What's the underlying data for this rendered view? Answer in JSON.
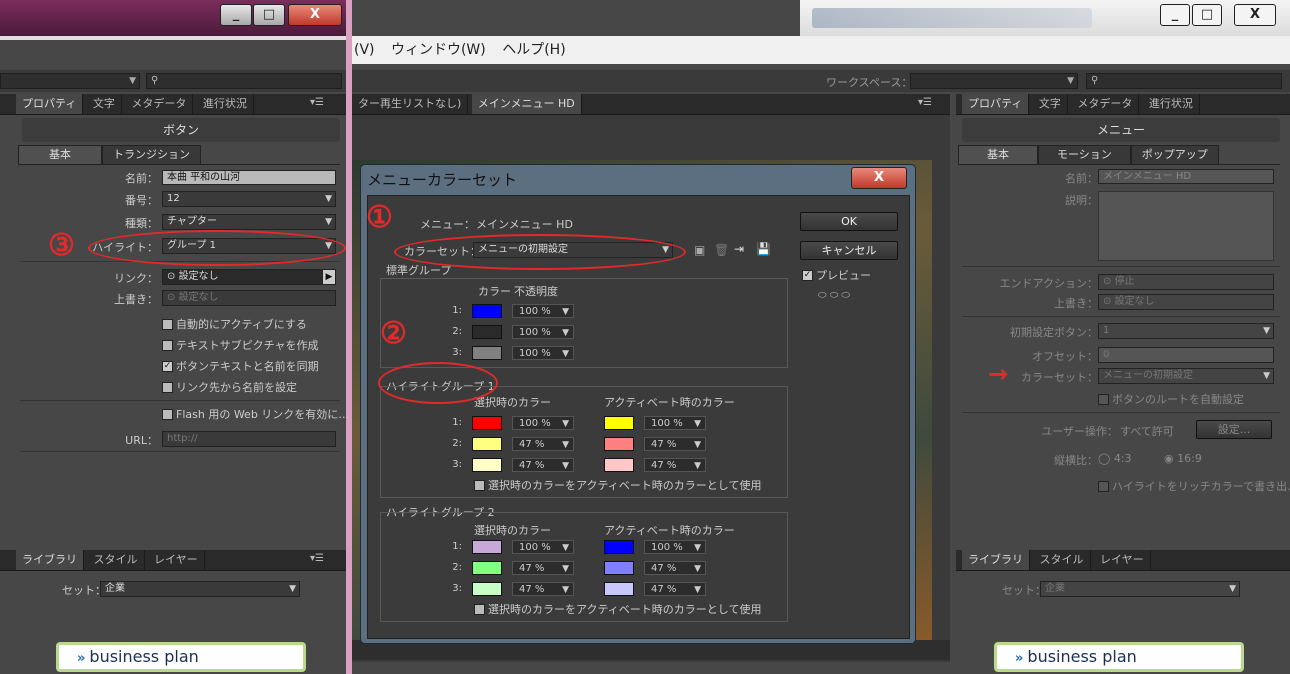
{
  "window": {
    "minimize": "_",
    "maximize": "□",
    "close": "X"
  },
  "menubar": {
    "items": [
      "(V)",
      "ウィンドウ(W)",
      "ヘルプ(H)"
    ]
  },
  "toolbar": {
    "workspace_label": "ワークスペース："
  },
  "left_panel": {
    "tabs": [
      "プロパティ",
      "文字",
      "メタデータ",
      "進行状況"
    ],
    "header": "ボタン",
    "subtabs": [
      "基本",
      "トランジション"
    ],
    "fields": {
      "name_label": "名前：",
      "name_value": "本曲 平和の山河",
      "number_label": "番号：",
      "number_value": "12",
      "type_label": "種類：",
      "type_value": "チャプター",
      "highlight_label": "ハイライト：",
      "highlight_value": "グループ 1",
      "link_label": "リンク：",
      "link_value": "設定なし",
      "override_label": "上書き：",
      "override_value": "設定なし",
      "url_label": "URL：",
      "url_placeholder": "http://"
    },
    "checkboxes": [
      {
        "label": "自動的にアクティブにする",
        "checked": false
      },
      {
        "label": "テキストサブピクチャを作成",
        "checked": false
      },
      {
        "label": "ボタンテキストと名前を同期",
        "checked": true
      },
      {
        "label": "リンク先から名前を設定",
        "checked": false
      },
      {
        "label": "Flash 用の Web リンクを有効に…",
        "checked": false
      }
    ],
    "library": {
      "tabs": [
        "ライブラリ",
        "スタイル",
        "レイヤー"
      ],
      "set_label": "セット：",
      "set_value": "企業"
    }
  },
  "center": {
    "tabs": [
      "ター再生リストなし)",
      "メインメニュー HD"
    ]
  },
  "dialog": {
    "title": "メニューカラーセット",
    "close": "X",
    "menu_label": "メニュー：",
    "menu_value": "メインメニュー HD",
    "colorset_label": "カラーセット：",
    "colorset_value": "メニューの初期設定",
    "ok": "OK",
    "cancel": "キャンセル",
    "preview": "プレビュー",
    "standard": {
      "title": "標準グループ",
      "col_color": "カラー",
      "col_opacity": "不透明度",
      "rows": [
        {
          "n": "1:",
          "color": "#0000ff",
          "pct": "100 %"
        },
        {
          "n": "2:",
          "color": "#2a2a2a",
          "pct": "100 %"
        },
        {
          "n": "3:",
          "color": "#808080",
          "pct": "100 %"
        }
      ]
    },
    "hg1": {
      "title": "ハイライトグループ 1",
      "col_sel": "選択時のカラー",
      "col_act": "アクティベート時のカラー",
      "rows": [
        {
          "n": "1:",
          "sel": "#ff0000",
          "selpct": "100 %",
          "act": "#ffff00",
          "actpct": "100 %"
        },
        {
          "n": "2:",
          "sel": "#ffff80",
          "selpct": "47 %",
          "act": "#ff8080",
          "actpct": "47 %"
        },
        {
          "n": "3:",
          "sel": "#ffffc8",
          "selpct": "47 %",
          "act": "#ffc8c8",
          "actpct": "47 %"
        }
      ],
      "checkbox": "選択時のカラーをアクティベート時のカラーとして使用"
    },
    "hg2": {
      "title": "ハイライトグループ 2",
      "col_sel": "選択時のカラー",
      "col_act": "アクティベート時のカラー",
      "rows": [
        {
          "n": "1:",
          "sel": "#c8a8d8",
          "selpct": "100 %",
          "act": "#0000ff",
          "actpct": "100 %"
        },
        {
          "n": "2:",
          "sel": "#80ff80",
          "selpct": "47 %",
          "act": "#8080ff",
          "actpct": "47 %"
        },
        {
          "n": "3:",
          "sel": "#c8ffc8",
          "selpct": "47 %",
          "act": "#c8c8ff",
          "actpct": "47 %"
        }
      ],
      "checkbox": "選択時のカラーをアクティベート時のカラーとして使用"
    }
  },
  "right_panel": {
    "tabs": [
      "プロパティ",
      "文字",
      "メタデータ",
      "進行状況"
    ],
    "header": "メニュー",
    "subtabs": [
      "基本",
      "モーション",
      "ポップアップ"
    ],
    "fields": {
      "name_label": "名前：",
      "name_value": "メインメニュー HD",
      "desc_label": "説明：",
      "endaction_label": "エンドアクション：",
      "endaction_value": "停止",
      "override_label": "上書き：",
      "override_value": "設定なし",
      "initbtn_label": "初期設定ボタン：",
      "initbtn_value": "1",
      "offset_label": "オフセット：",
      "offset_value": "0",
      "colorset_label": "カラーセット：",
      "colorset_value": "メニューの初期設定",
      "autoroute": "ボタンのルートを自動設定",
      "userop_label": "ユーザー操作：",
      "userop_value": "すべて許可",
      "userop_btn": "設定...",
      "aspect_label": "縦横比：",
      "aspect_a": "4:3",
      "aspect_b": "16:9",
      "richcolor": "ハイライトをリッチカラーで書き出..."
    },
    "library": {
      "tabs": [
        "ライブラリ",
        "スタイル",
        "レイヤー"
      ],
      "set_label": "セット：",
      "set_value": "企業"
    }
  },
  "annotations": {
    "one": "①",
    "two": "②",
    "three": "③",
    "arrow": "→"
  },
  "banner": {
    "text": "business plan",
    "chev": "»"
  }
}
